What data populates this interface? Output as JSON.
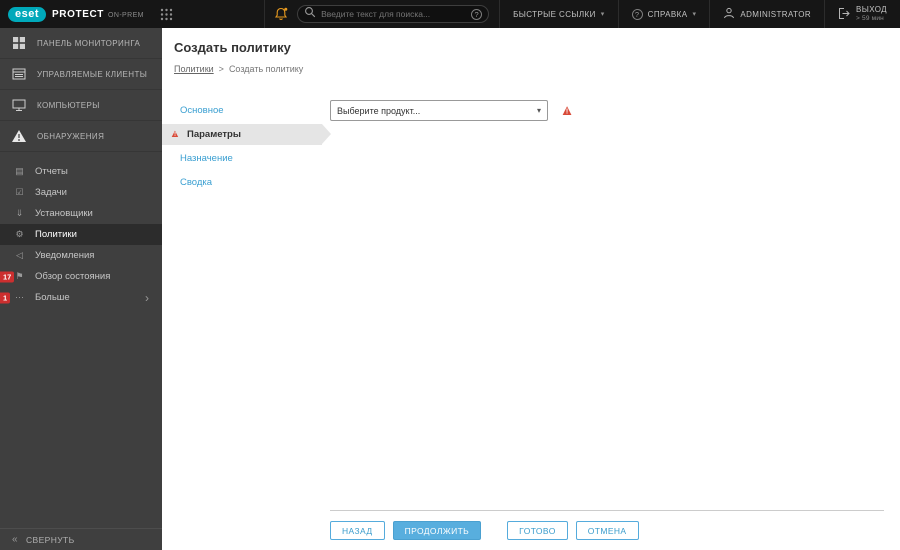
{
  "topbar": {
    "logo_text": "eset",
    "product": "PROTECT",
    "product_suffix": "ON-PREM",
    "search_placeholder": "Введите текст для поиска...",
    "quick_links": "БЫСТРЫЕ ССЫЛКИ",
    "help": "СПРАВКА",
    "user": "ADMINISTRATOR",
    "logout": "ВЫХОД",
    "logout_timer": "> 59 мин"
  },
  "sidebar": {
    "primary": [
      {
        "label": "ПАНЕЛЬ МОНИТОРИНГА"
      },
      {
        "label": "УПРАВЛЯЕМЫЕ КЛИЕНТЫ"
      },
      {
        "label": "КОМПЬЮТЕРЫ"
      },
      {
        "label": "ОБНАРУЖЕНИЯ"
      }
    ],
    "secondary": [
      {
        "label": "Отчеты"
      },
      {
        "label": "Задачи"
      },
      {
        "label": "Установщики"
      },
      {
        "label": "Политики",
        "selected": true
      },
      {
        "label": "Уведомления"
      },
      {
        "label": "Обзор состояния",
        "badge": "17"
      },
      {
        "label": "Больше",
        "badge": "1"
      }
    ],
    "collapse": "СВЕРНУТЬ"
  },
  "page": {
    "title": "Создать политику",
    "breadcrumb_link": "Политики",
    "breadcrumb_sep": ">",
    "breadcrumb_current": "Создать политику"
  },
  "wizard": {
    "steps": [
      {
        "label": "Основное"
      },
      {
        "label": "Параметры",
        "selected": true,
        "warning": true
      },
      {
        "label": "Назначение"
      },
      {
        "label": "Сводка"
      }
    ],
    "product_select_value": "Выберите продукт...",
    "buttons": {
      "back": "НАЗАД",
      "continue": "ПРОДОЛЖИТЬ",
      "finish": "ГОТОВО",
      "cancel": "ОТМЕНА"
    }
  },
  "icons": {
    "chevron_down": "▾",
    "chevron_right": "›",
    "question_mark": "?",
    "exclamation": "!",
    "warning_triangle": "▲",
    "reports": "▤",
    "tasks": "☑",
    "installers": "⇓",
    "policies": "⚙",
    "notifications": "◁",
    "status_overview": "⚑",
    "more": "⋯",
    "collapse": "«"
  },
  "colors": {
    "brand_teal": "#00a9ba",
    "accent_blue": "#58aede",
    "warning_red": "#d84a38",
    "bell_orange": "#e6991f",
    "badge_red": "#cc2f2f",
    "topbar_bg": "#161616",
    "sidebar_bg": "#3f3f3f"
  }
}
